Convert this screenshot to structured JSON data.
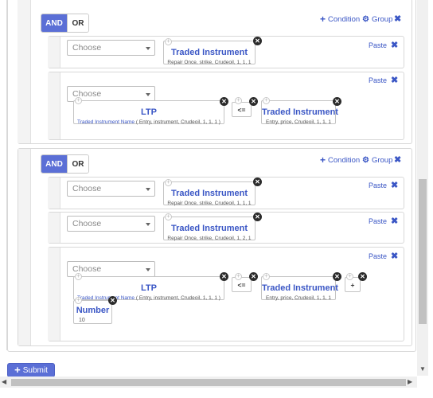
{
  "groups": [
    {
      "toggle": {
        "and": "AND",
        "or": "OR"
      },
      "actions": {
        "condition": "Condition",
        "group": "Group"
      },
      "rows": [
        {
          "select": "Choose",
          "paste": "Paste",
          "cards": [
            {
              "title": "Traded Instrument",
              "sub": "Repair Once, strike, Crudeoil, 1, 1, 1"
            }
          ]
        },
        {
          "select": "Choose",
          "paste": "Paste",
          "cards": [
            {
              "title": "LTP",
              "sub_link": "Traded Instrument Name",
              "sub": " ( Entry, instrument, Crudeoil, 1, 1, 1 )"
            },
            {
              "operator": "<="
            },
            {
              "title": "Traded Instrument",
              "sub": "Entry, price, Crudeoil, 1, 1, 1"
            }
          ]
        }
      ]
    },
    {
      "toggle": {
        "and": "AND",
        "or": "OR"
      },
      "actions": {
        "condition": "Condition",
        "group": "Group"
      },
      "rows": [
        {
          "select": "Choose",
          "paste": "Paste",
          "cards": [
            {
              "title": "Traded Instrument",
              "sub": "Repair Once, strike, Crudeoil, 1, 1, 1"
            }
          ]
        },
        {
          "select": "Choose",
          "paste": "Paste",
          "cards": [
            {
              "title": "Traded Instrument",
              "sub": "Repair Once, strike, Crudeoil, 1, 2, 1"
            }
          ]
        },
        {
          "select": "Choose",
          "paste": "Paste",
          "cards": [
            {
              "title": "LTP",
              "sub_link": "Traded Instrument Name",
              "sub": " ( Entry, instrument, Crudeoil, 1, 1, 1 )"
            },
            {
              "operator": "<="
            },
            {
              "title": "Traded Instrument",
              "sub": "Entry, price, Crudeoil, 1, 1, 1"
            },
            {
              "operator": "+"
            },
            {
              "title": "Number",
              "sub": "10"
            }
          ]
        }
      ]
    }
  ],
  "submit": "Submit",
  "icons": {
    "plus": "plus-icon",
    "gear": "gear-icon",
    "close": "close-icon",
    "remove": "x-icon"
  },
  "colors": {
    "accent": "#5b6fd6",
    "link": "#3a56c5"
  }
}
